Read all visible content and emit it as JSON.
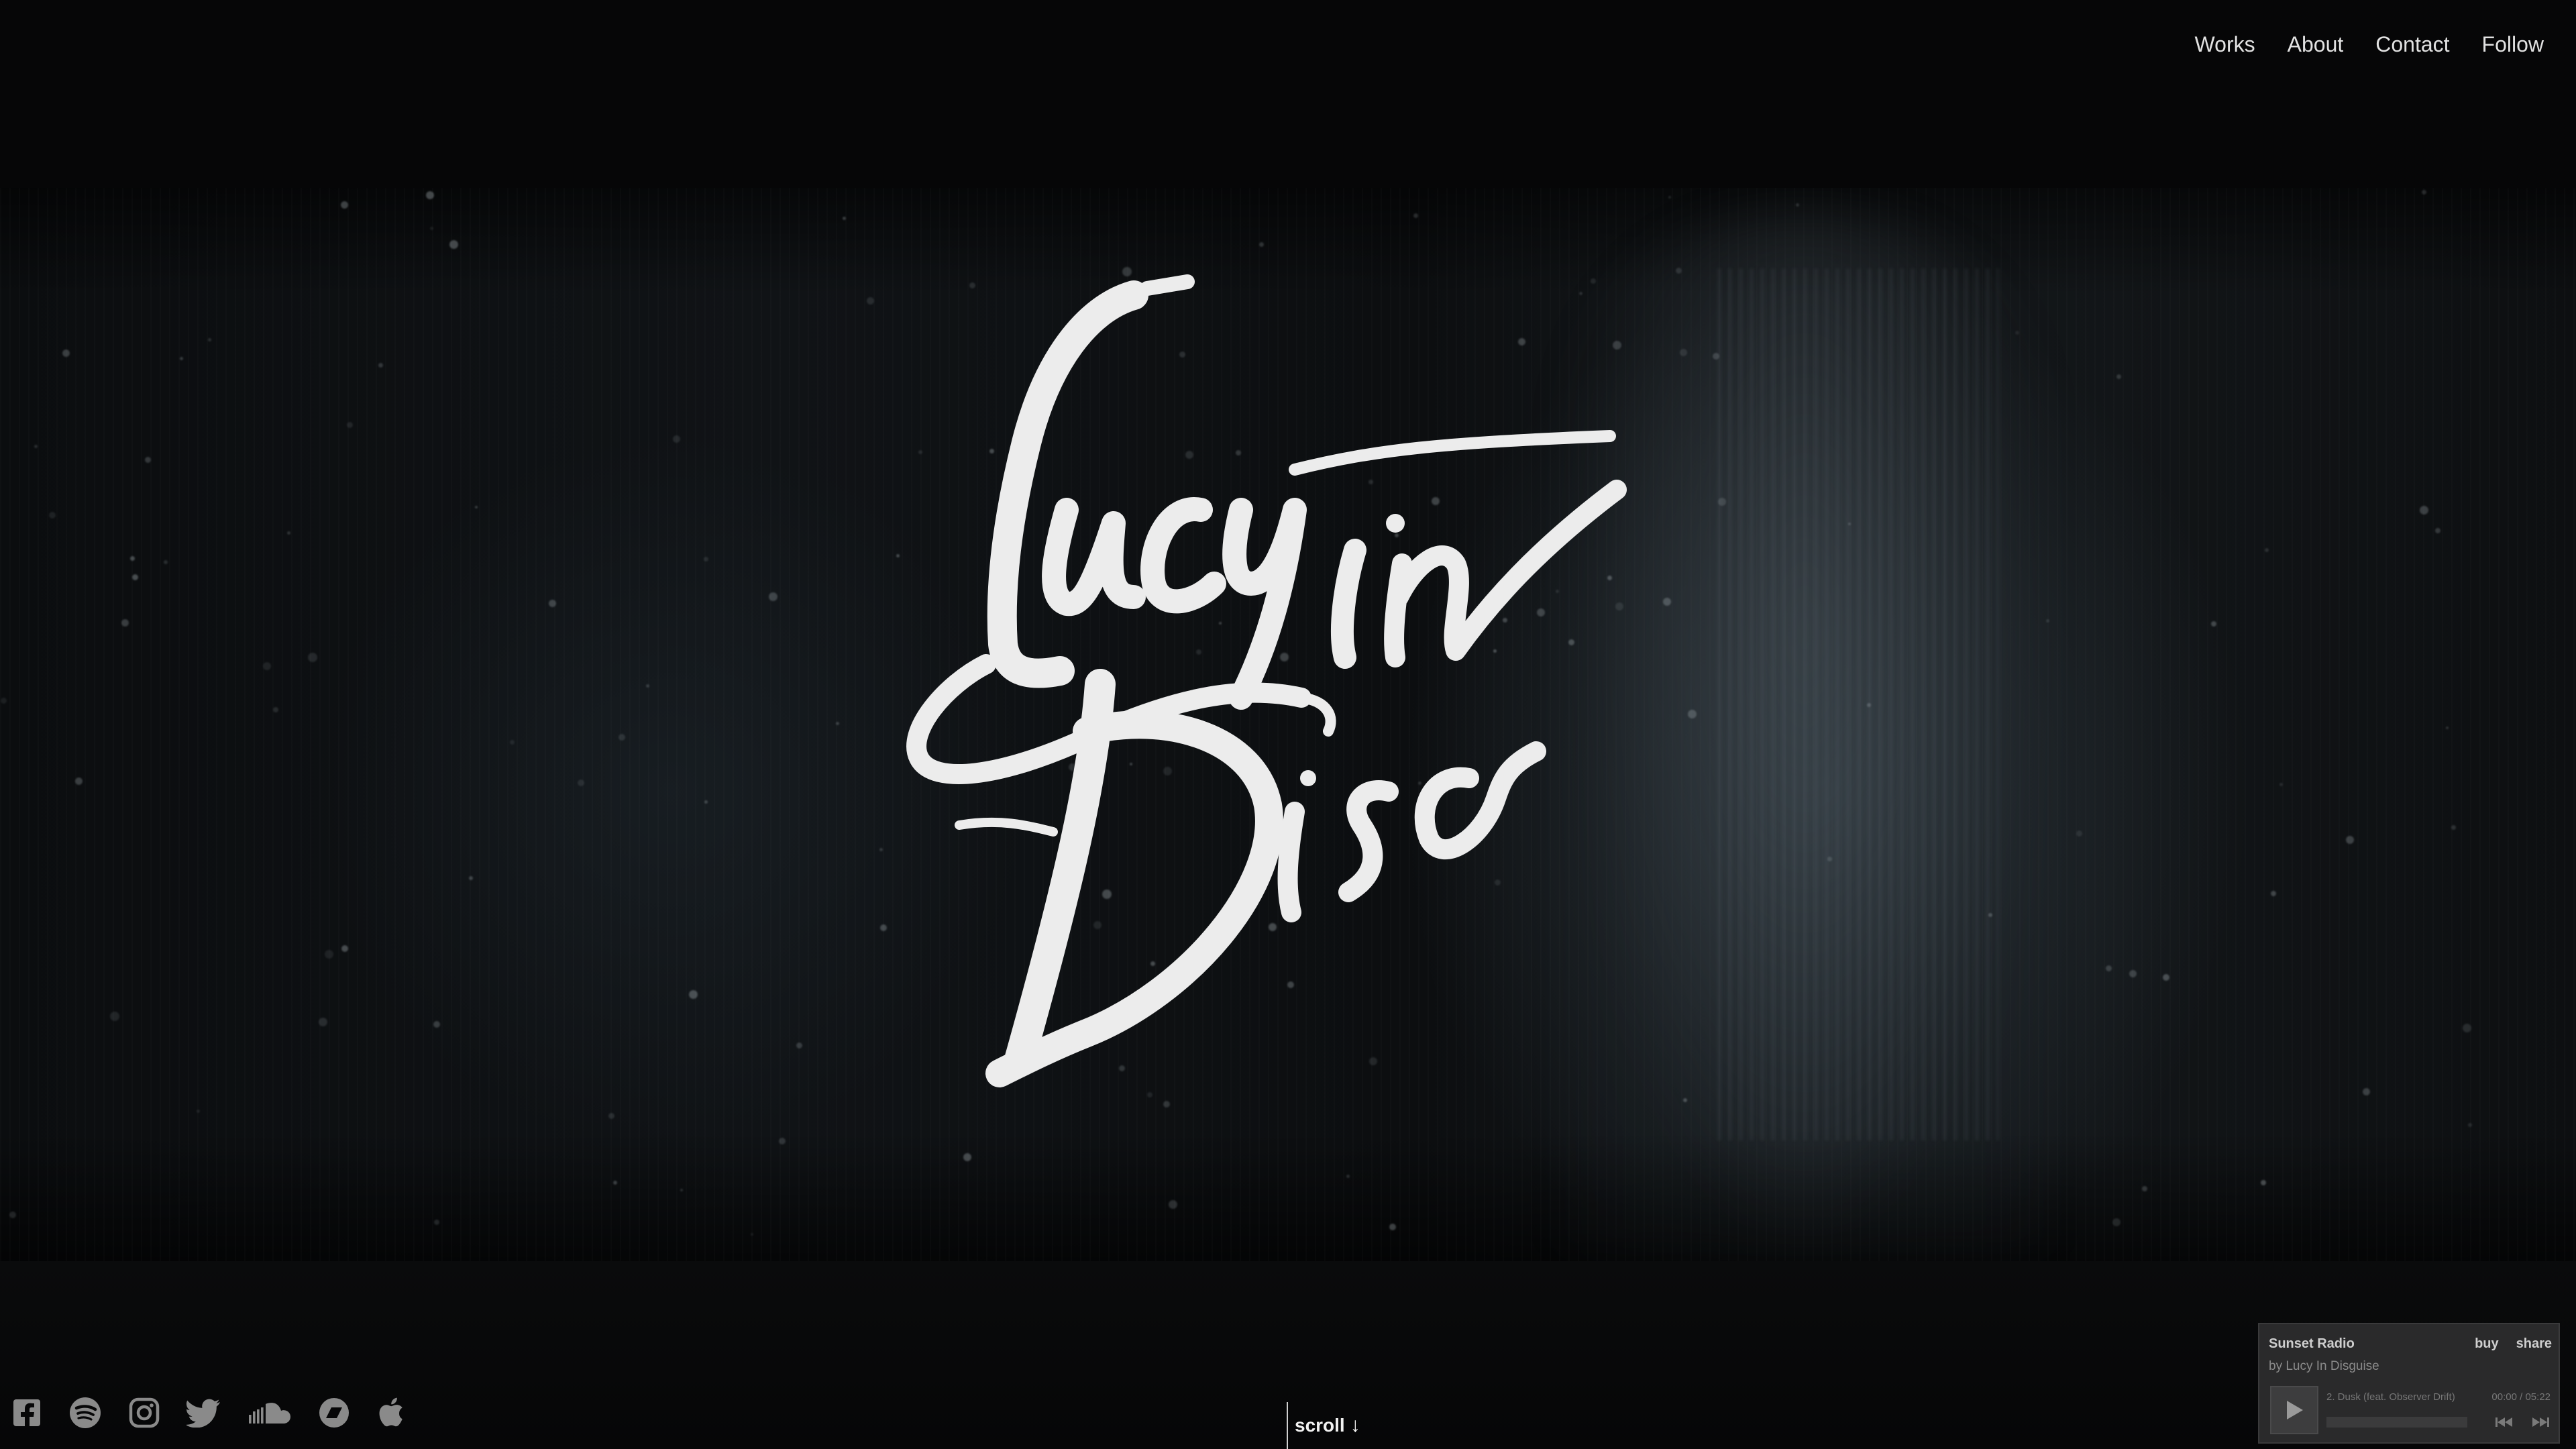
{
  "nav": {
    "items": [
      {
        "label": "Works"
      },
      {
        "label": "About"
      },
      {
        "label": "Contact"
      },
      {
        "label": "Follow"
      }
    ]
  },
  "logo": {
    "text": "Lucy in Disg",
    "color": "#ececec"
  },
  "social": {
    "icons": [
      "facebook-icon",
      "spotify-icon",
      "instagram-icon",
      "twitter-icon",
      "soundcloud-icon",
      "bandcamp-icon",
      "apple-icon"
    ]
  },
  "scroll": {
    "label": "scroll",
    "arrow": "↓"
  },
  "player": {
    "title": "Sunset Radio",
    "artist": "by Lucy In Disguise",
    "buy_label": "buy",
    "share_label": "share",
    "track": "2. Dusk (feat. Observer Drift)",
    "time": "00:00 / 05:22",
    "progress": 0
  }
}
